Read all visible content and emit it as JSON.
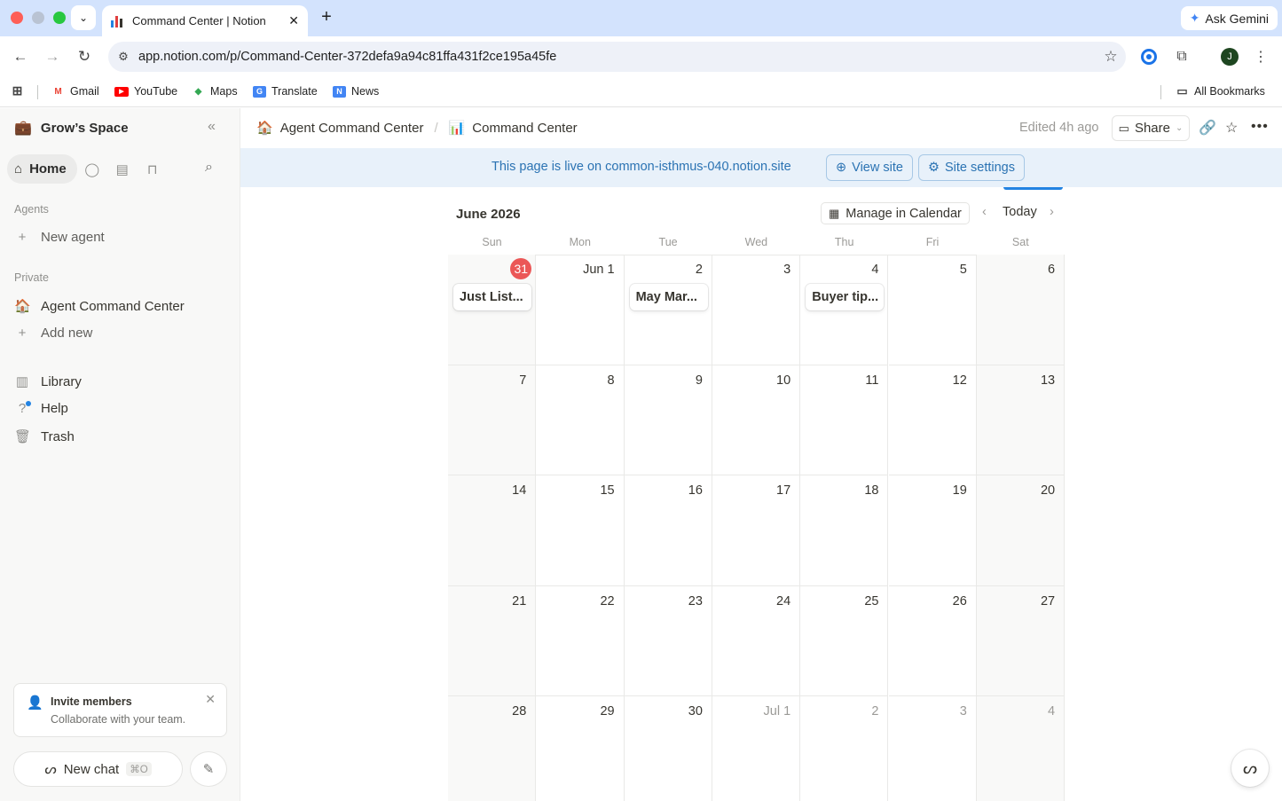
{
  "browser": {
    "tab_title": "Command Center | Notion",
    "tab_close": "✕",
    "new_tab": "+",
    "gemini_label": "Ask Gemini",
    "url": "app.notion.com/p/Command-Center-372defa9a94c81ffa431f2ce195a45fe",
    "profile_initial": "J",
    "bookmarks": [
      {
        "label": "Gmail",
        "icon": "gmail-icon",
        "glyph": "M",
        "color": "#ea4335"
      },
      {
        "label": "YouTube",
        "icon": "youtube-icon",
        "glyph": "▶",
        "color": "#ff0000"
      },
      {
        "label": "Maps",
        "icon": "maps-icon",
        "glyph": "◆",
        "color": "#34a853"
      },
      {
        "label": "Translate",
        "icon": "translate-icon",
        "glyph": "G",
        "color": "#4285f4"
      },
      {
        "label": "News",
        "icon": "news-icon",
        "glyph": "N",
        "color": "#4285f4"
      }
    ],
    "all_bookmarks": "All Bookmarks"
  },
  "sidebar": {
    "workspace": "Grow’s Space",
    "home": "Home",
    "agents_section": "Agents",
    "new_agent": "New agent",
    "private_section": "Private",
    "page_agent_cc": "Agent Command Center",
    "add_new": "Add new",
    "library": "Library",
    "help": "Help",
    "trash": "Trash",
    "invite_title": "Invite members",
    "invite_sub": "Collaborate with your team.",
    "new_chat": "New chat",
    "new_chat_shortcut": "⌘O"
  },
  "topbar": {
    "crumb_parent": "Agent Command Center",
    "crumb_current": "Command Center",
    "edited": "Edited 4h ago",
    "share": "Share"
  },
  "banner": {
    "message": "This page is live on common-isthmus-040.notion.site",
    "view_site": "View site",
    "site_settings": "Site settings"
  },
  "calendar": {
    "month": "June 2026",
    "manage": "Manage in Calendar",
    "today": "Today",
    "weekdays": [
      "Sun",
      "Mon",
      "Tue",
      "Wed",
      "Thu",
      "Fri",
      "Sat"
    ],
    "weeks": [
      [
        {
          "label": "31",
          "today": true,
          "event": "Just List..."
        },
        {
          "label": "Jun 1"
        },
        {
          "label": "2",
          "event": "May Mar..."
        },
        {
          "label": "3"
        },
        {
          "label": "4",
          "event": "Buyer tip..."
        },
        {
          "label": "5"
        },
        {
          "label": "6"
        }
      ],
      [
        {
          "label": "7"
        },
        {
          "label": "8"
        },
        {
          "label": "9"
        },
        {
          "label": "10"
        },
        {
          "label": "11"
        },
        {
          "label": "12"
        },
        {
          "label": "13"
        }
      ],
      [
        {
          "label": "14"
        },
        {
          "label": "15"
        },
        {
          "label": "16"
        },
        {
          "label": "17"
        },
        {
          "label": "18"
        },
        {
          "label": "19"
        },
        {
          "label": "20"
        }
      ],
      [
        {
          "label": "21"
        },
        {
          "label": "22"
        },
        {
          "label": "23"
        },
        {
          "label": "24"
        },
        {
          "label": "25"
        },
        {
          "label": "26"
        },
        {
          "label": "27"
        }
      ],
      [
        {
          "label": "28"
        },
        {
          "label": "29"
        },
        {
          "label": "30"
        },
        {
          "label": "Jul 1",
          "muted": true
        },
        {
          "label": "2",
          "muted": true
        },
        {
          "label": "3",
          "muted": true
        },
        {
          "label": "4",
          "muted": true
        }
      ]
    ]
  },
  "colors": {
    "accent_blue": "#2383e2",
    "today_red": "#eb5757",
    "banner_bg": "#e8f1fa",
    "banner_text": "#2b73b3"
  }
}
